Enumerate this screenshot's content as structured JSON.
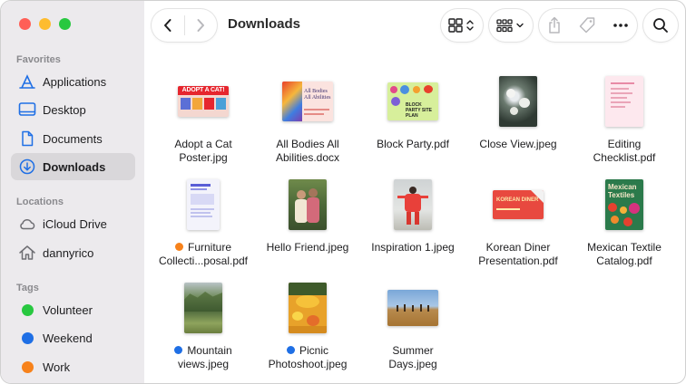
{
  "window": {
    "title": "Downloads"
  },
  "sidebar": {
    "favorites_title": "Favorites",
    "favorites": [
      {
        "label": "Applications",
        "icon": "applications-icon"
      },
      {
        "label": "Desktop",
        "icon": "desktop-icon"
      },
      {
        "label": "Documents",
        "icon": "documents-icon"
      },
      {
        "label": "Downloads",
        "icon": "downloads-icon",
        "selected": true
      }
    ],
    "locations_title": "Locations",
    "locations": [
      {
        "label": "iCloud Drive",
        "icon": "cloud-icon"
      },
      {
        "label": "dannyrico",
        "icon": "home-icon"
      }
    ],
    "tags_title": "Tags",
    "tags": [
      {
        "label": "Volunteer",
        "color": "#28c840"
      },
      {
        "label": "Weekend",
        "color": "#1f6fe5"
      },
      {
        "label": "Work",
        "color": "#f7821b"
      }
    ]
  },
  "toolbar": {
    "back_icon": "chevron-left-icon",
    "forward_icon": "chevron-right-icon",
    "view_icon": "grid-view-icon",
    "group_icon": "group-icon",
    "share_icon": "share-icon",
    "tag_icon": "tag-icon",
    "more_icon": "more-icon",
    "search_icon": "search-icon"
  },
  "files": [
    {
      "line1": "Adopt a Cat",
      "line2": "Poster.jpg",
      "tag": null
    },
    {
      "line1": "All Bodies All",
      "line2": "Abilities.docx",
      "tag": null
    },
    {
      "line1": "Block Party.pdf",
      "line2": "",
      "tag": null
    },
    {
      "line1": "Close View.jpeg",
      "line2": "",
      "tag": null
    },
    {
      "line1": "Editing",
      "line2": "Checklist.pdf",
      "tag": null
    },
    {
      "line1": "Furniture",
      "line2": "Collecti...posal.pdf",
      "tag": "#f7821b"
    },
    {
      "line1": "Hello Friend.jpeg",
      "line2": "",
      "tag": null
    },
    {
      "line1": "Inspiration 1.jpeg",
      "line2": "",
      "tag": null
    },
    {
      "line1": "Korean Diner",
      "line2": "Presentation.pdf",
      "tag": null
    },
    {
      "line1": "Mexican Textile",
      "line2": "Catalog.pdf",
      "tag": null
    },
    {
      "line1": "Mountain",
      "line2": "views.jpeg",
      "tag": "#1f6fe5"
    },
    {
      "line1": "Picnic",
      "line2": "Photoshoot.jpeg",
      "tag": "#1f6fe5"
    },
    {
      "line1": "Summer",
      "line2": "Days.jpeg",
      "tag": null
    }
  ],
  "thumb_text": {
    "adopt_cat": "ADOPT A CAT!",
    "all_bodies": "All Bodies All Abilities",
    "block_party": "BLOCK PARTY SITE PLAN",
    "korean_diner": "KOREAN DINER",
    "mexican_textiles": "Mexican Textiles"
  },
  "colors": {
    "sidebar_bg": "#eceaed",
    "selected_bg": "#d9d7da",
    "accent": "#1f6fe5"
  }
}
